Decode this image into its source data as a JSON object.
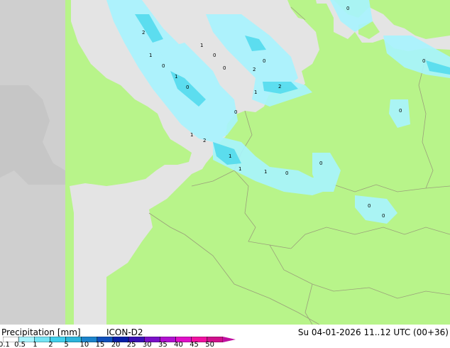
{
  "map": {
    "colors": {
      "sea": "#e4e4e4",
      "land": "#b8f48a",
      "outside": "#cfcfcf",
      "border_land": "#d2d2a6",
      "border_outside": "#a0a0a0",
      "precip_light": "#a8f4ff",
      "precip_medium": "#48d8ec"
    },
    "marker_labels": [
      "0",
      "1",
      "2"
    ]
  },
  "footer": {
    "title": "Precipitation [mm]",
    "model": "ICON-D2",
    "validity": "Su 04-01-2026 11..12 UTC (00+36)"
  },
  "legend": {
    "ticks": [
      "0.1",
      "0.5",
      "1",
      "2",
      "5",
      "10",
      "15",
      "20",
      "25",
      "30",
      "35",
      "40",
      "45",
      "50"
    ],
    "colors": [
      "#ffffff",
      "#a8f4ff",
      "#74e4f4",
      "#40d0ec",
      "#2cb4dc",
      "#1c84cc",
      "#1050bc",
      "#0820a8",
      "#3a10b4",
      "#7a10c8",
      "#b010d0",
      "#e010c8",
      "#f010a0",
      "#d0108c"
    ]
  }
}
